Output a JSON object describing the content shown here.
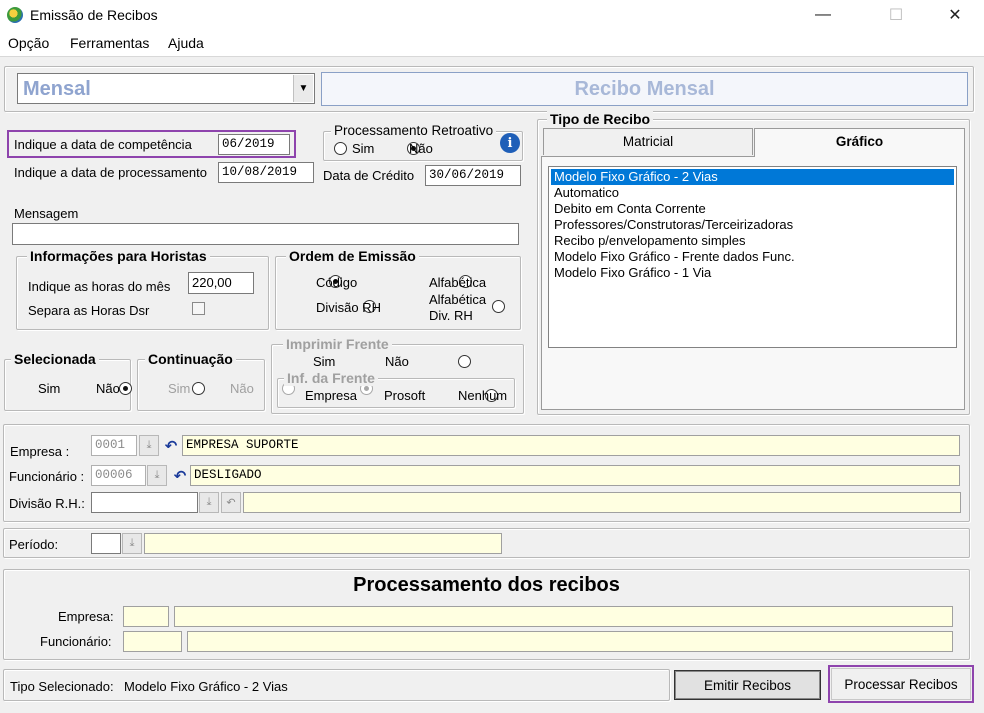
{
  "window": {
    "title": "Emissão de Recibos",
    "minimize": "—",
    "maximize": "☐",
    "close": "✕"
  },
  "menu": [
    "Opção",
    "Ferramentas",
    "Ajuda"
  ],
  "top": {
    "mode_value": "Mensal",
    "banner": "Recibo Mensal"
  },
  "dates": {
    "competencia_label": "Indique a data de competência",
    "competencia_value": "06/2019",
    "processamento_label": "Indique a data de processamento",
    "processamento_value": "10/08/2019",
    "credito_label": "Data de Crédito",
    "credito_value": "30/06/2019"
  },
  "retro": {
    "legend": "Processamento Retroativo",
    "sim": "Sim",
    "nao": "Não",
    "selected": "nao"
  },
  "mensagem": {
    "label": "Mensagem",
    "value": ""
  },
  "horistas": {
    "legend": "Informações para Horistas",
    "horas_label": "Indique as horas do mês",
    "horas_value": "220,00",
    "dsr_label": "Separa as Horas Dsr"
  },
  "ordem": {
    "legend": "Ordem de Emissão",
    "codigo": "Código",
    "alfabetica": "Alfabética",
    "divisao": "Divisão RH",
    "alfa_div_1": "Alfabética",
    "alfa_div_2": "Div.  RH"
  },
  "selecionada": {
    "legend": "Selecionada",
    "sim": "Sim",
    "nao": "Não"
  },
  "continuacao": {
    "legend": "Continuação",
    "sim": "Sim",
    "nao": "Não"
  },
  "imprimir": {
    "legend": "Imprimir Frente",
    "sim": "Sim",
    "nao": "Não",
    "inf_legend": "Inf. da Frente",
    "empresa": "Empresa",
    "prosoft": "Prosoft",
    "nenhum": "Nenhum"
  },
  "tipo": {
    "legend": "Tipo de Recibo",
    "tabs": [
      "Matricial",
      "Gráfico"
    ],
    "items": [
      "Modelo Fixo Gráfico - 2 Vias",
      "Automatico",
      "Debito em Conta Corrente",
      "Professores/Construtoras/Terceirizadoras",
      "Recibo p/envelopamento simples",
      "Modelo Fixo Gráfico - Frente dados Func.",
      "Modelo Fixo Gráfico - 1 Via"
    ]
  },
  "filters": {
    "empresa_label": "Empresa :",
    "empresa_code": "0001",
    "empresa_name": "EMPRESA SUPORTE",
    "func_label": "Funcionário :",
    "func_code": "00006",
    "func_name": "DESLIGADO",
    "divisao_label": "Divisão R.H.:",
    "periodo_label": "Período:"
  },
  "proc": {
    "title": "Processamento dos recibos",
    "empresa_label": "Empresa:",
    "func_label": "Funcionário:"
  },
  "footer": {
    "tipo_label": "Tipo Selecionado:",
    "tipo_value": "Modelo Fixo Gráfico - 2 Vias",
    "emitir": "Emitir Recibos",
    "processar": "Processar Recibos"
  },
  "colors": {
    "highlight": "#8e44ad",
    "selection": "#0078d7",
    "field_yellow": "#ffffe1",
    "banner_text": "#a8b8d8",
    "mode_text": "#8fa4cf"
  }
}
